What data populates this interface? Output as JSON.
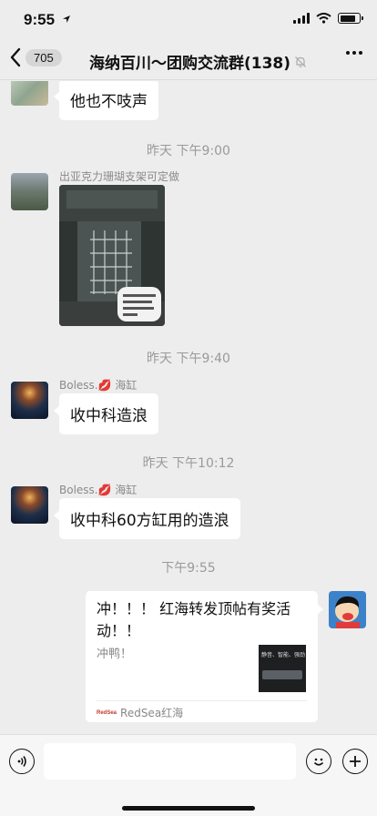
{
  "status": {
    "time": "9:55"
  },
  "nav": {
    "unread": "705",
    "title": "海纳百川～团购交流群(138)"
  },
  "messages": {
    "m1": {
      "text": "他也不吱声"
    },
    "ts1": "昨天 下午9:00",
    "m2": {
      "sender": "出亚克力珊瑚支架可定做",
      "photo_caption": "出亚克力珊瑚支架 可定做"
    },
    "ts2": "昨天 下午9:40",
    "m3": {
      "sender": "Boless.💋 海缸",
      "text": "收中科造浪"
    },
    "ts3": "昨天 下午10:12",
    "m4": {
      "sender": "Boless.💋 海缸",
      "text": "收中科60方缸用的造浪"
    },
    "ts4": "下午9:55",
    "m5": {
      "title": "冲！！！ 红海转发顶帖有奖活动！！",
      "desc": "冲鸭！",
      "thumb_text": "静音、智能、强劲",
      "source_logo": "RedSea",
      "source": "RedSea红海"
    }
  },
  "input": {
    "placeholder": ""
  }
}
